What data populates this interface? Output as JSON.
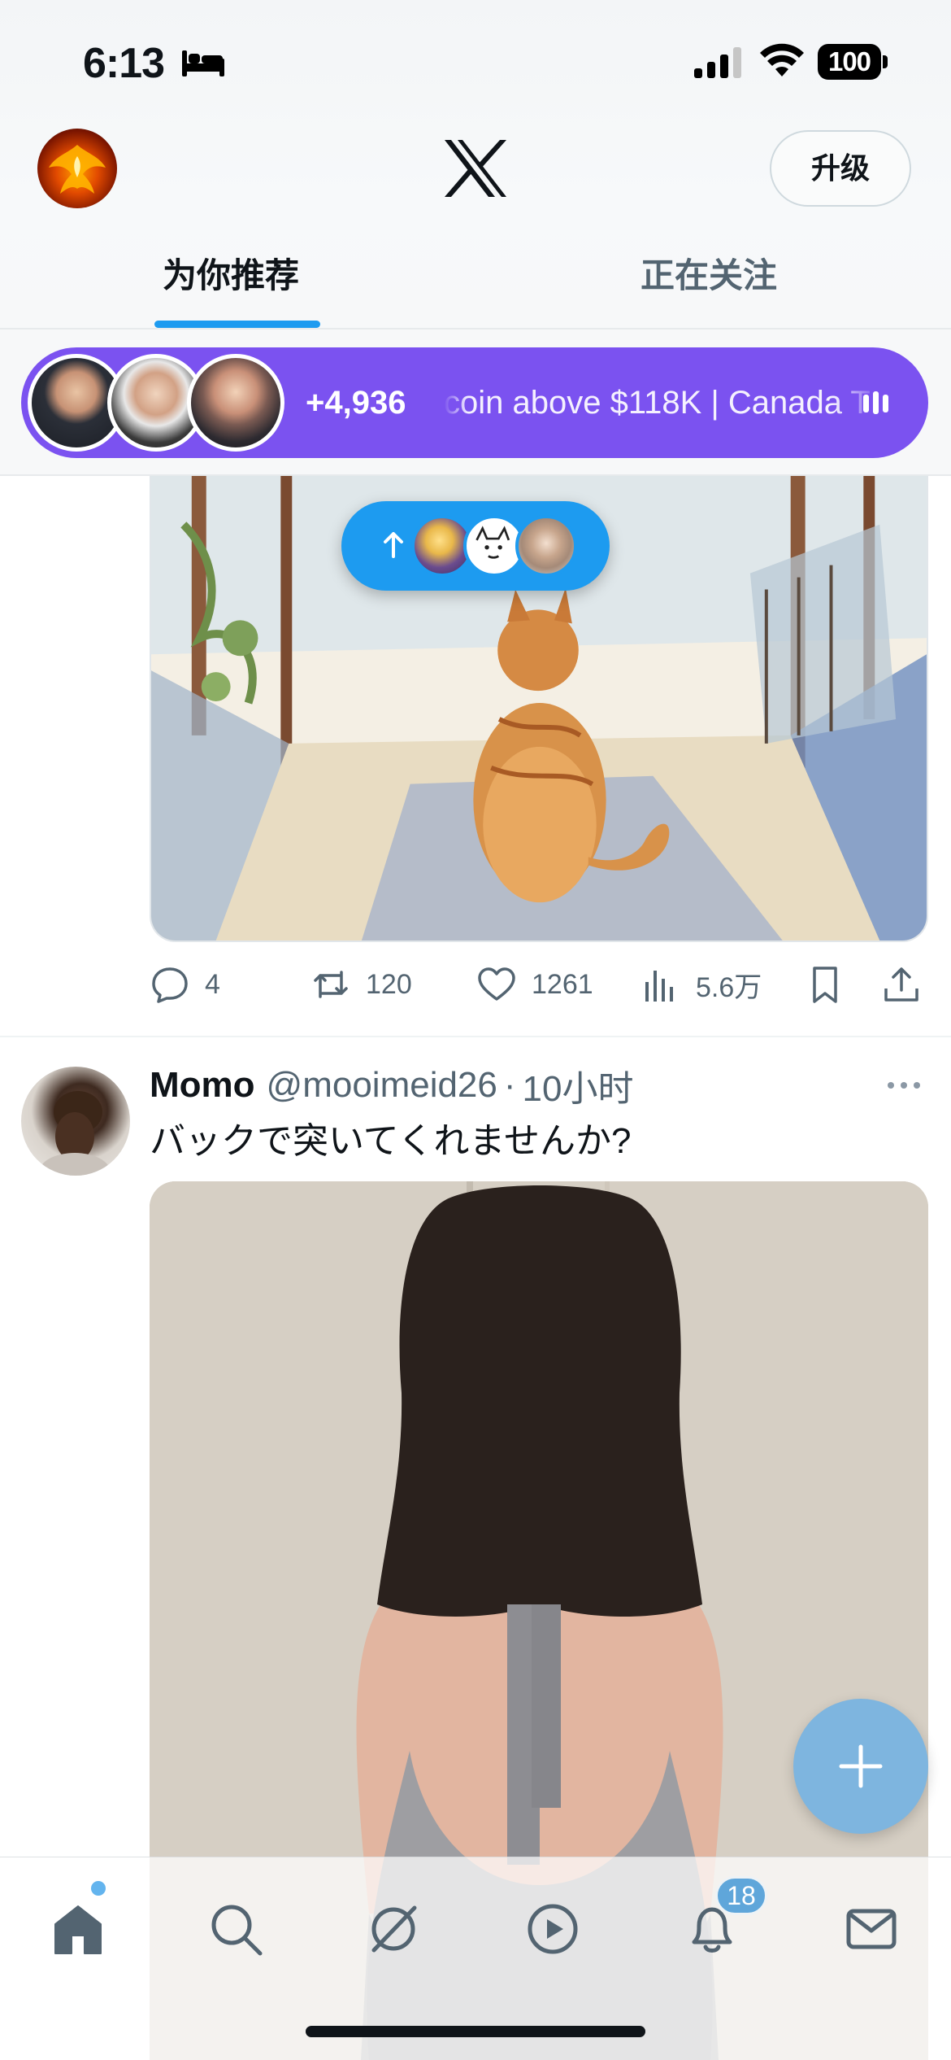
{
  "status_bar": {
    "time": "6:13",
    "battery": "100"
  },
  "header": {
    "logo": "X",
    "upgrade_label": "升级",
    "tabs": [
      {
        "label": "为你推荐",
        "active": true
      },
      {
        "label": "正在关注",
        "active": false
      }
    ]
  },
  "spaces": {
    "listener_count": "+4,936",
    "title": "coin above $118K | Canada T",
    "color": "#7b52f0"
  },
  "new_posts_pill": {
    "icon": "arrow-up-icon",
    "color": "#1d9bf0"
  },
  "tweet1": {
    "replies": "4",
    "retweets": "120",
    "likes": "1261",
    "views": "5.6万"
  },
  "tweet2": {
    "name": "Momo",
    "handle": "@mooimeid26",
    "separator": "·",
    "time": "10小时",
    "text": "バックで突いてくれませんか?"
  },
  "bottom_nav": {
    "notifications_badge": "18",
    "items": [
      "home-icon",
      "search-icon",
      "grok-icon",
      "video-icon",
      "notifications-icon",
      "messages-icon"
    ]
  },
  "colors": {
    "accent": "#1d9bf0",
    "text_primary": "#0f1419",
    "text_secondary": "#536471"
  }
}
